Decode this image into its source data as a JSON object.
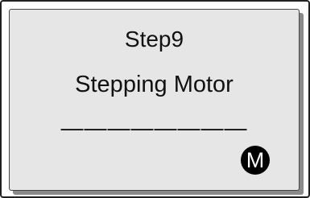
{
  "display": {
    "step_label": "Step9",
    "item_name": "Stepping Motor",
    "value_placeholder": "————————",
    "mode_badge": "M"
  },
  "colors": {
    "panel_background": "#e6e6e6",
    "panel_shadow": "#8a8a8a",
    "badge_background": "#000000",
    "badge_text": "#ffffff"
  }
}
